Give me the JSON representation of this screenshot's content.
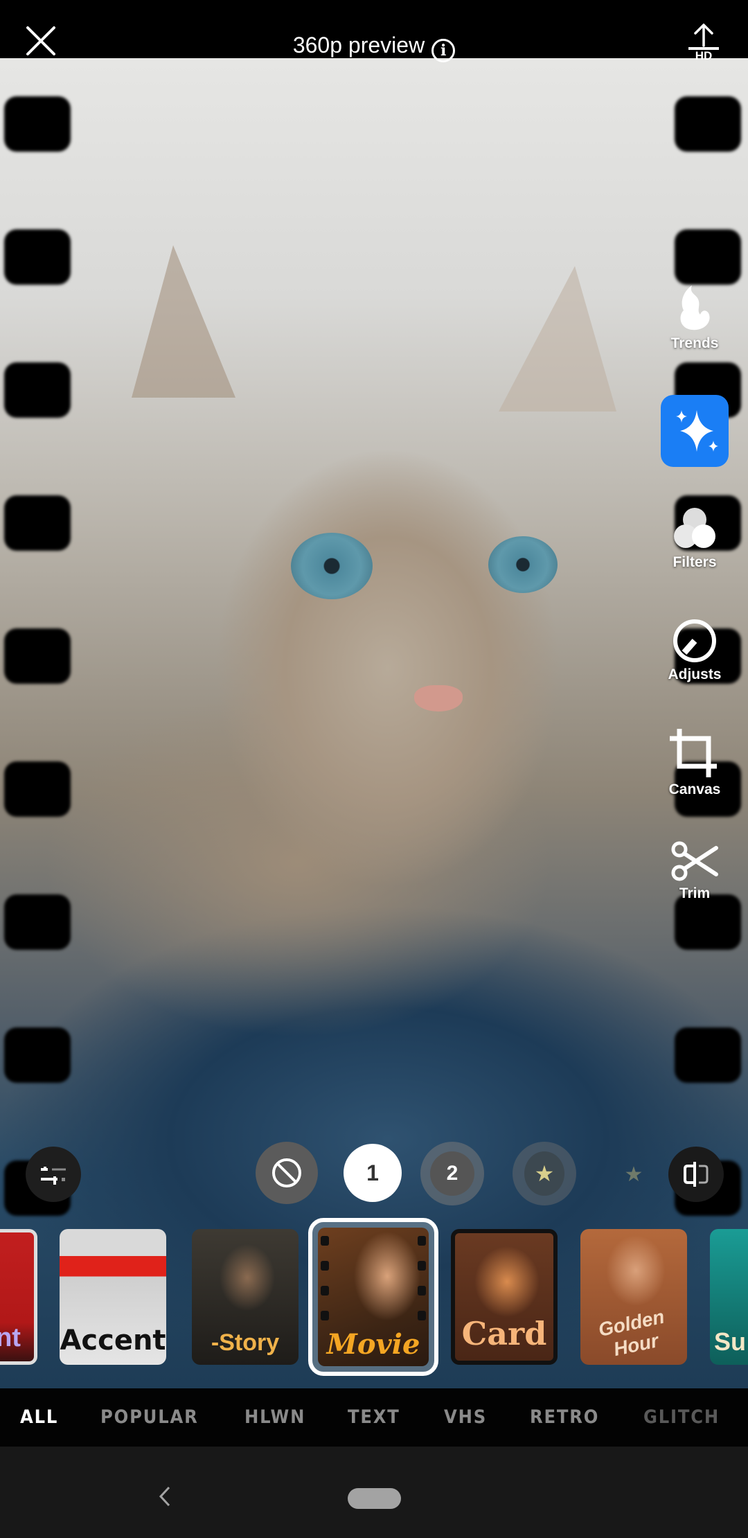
{
  "topbar": {
    "title": "360p preview",
    "info_icon": "info-icon",
    "close_icon": "close-icon",
    "export_icon": "upload-icon",
    "export_badge": "HD"
  },
  "rail": {
    "items": [
      {
        "label": "Trends",
        "icon": "flame-icon"
      },
      {
        "label": "",
        "icon": "sparkles-icon",
        "accent": "#1a7ef5"
      },
      {
        "label": "Filters",
        "icon": "filters-circles-icon"
      },
      {
        "label": "Adjusts",
        "icon": "dial-icon"
      },
      {
        "label": "Canvas",
        "icon": "crop-icon"
      },
      {
        "label": "Trim",
        "icon": "scissors-icon"
      }
    ]
  },
  "controls": {
    "adjust_icon": "sliders-icon",
    "none_icon": "no-filter-icon",
    "variant_1": "1",
    "variant_2": "2",
    "star_1": "★",
    "star_2": "★",
    "compare_icon": "compare-icon"
  },
  "filters": {
    "items": [
      {
        "label": "nt",
        "text_color": "#b9a6f2"
      },
      {
        "label": "Accent",
        "text_color": "#111111"
      },
      {
        "label": "-Story",
        "text_color": "#f0b24a"
      },
      {
        "label": "Movie",
        "text_color": "#f4a623",
        "selected": true
      },
      {
        "label": "Card",
        "text_color": "#f7b57a"
      },
      {
        "label": "Golden Hour",
        "text_color": "#f5dcc4"
      },
      {
        "label": "Su",
        "text_color": "#f4e7c6"
      }
    ]
  },
  "tabs": [
    {
      "label": "ALL",
      "active": true
    },
    {
      "label": "POPULAR"
    },
    {
      "label": "HLWN"
    },
    {
      "label": "TEXT"
    },
    {
      "label": "VHS"
    },
    {
      "label": "RETRO"
    },
    {
      "label": "GLITCH"
    }
  ],
  "navbar": {
    "back_icon": "back-chevron-icon",
    "home_icon": "home-pill-icon"
  }
}
